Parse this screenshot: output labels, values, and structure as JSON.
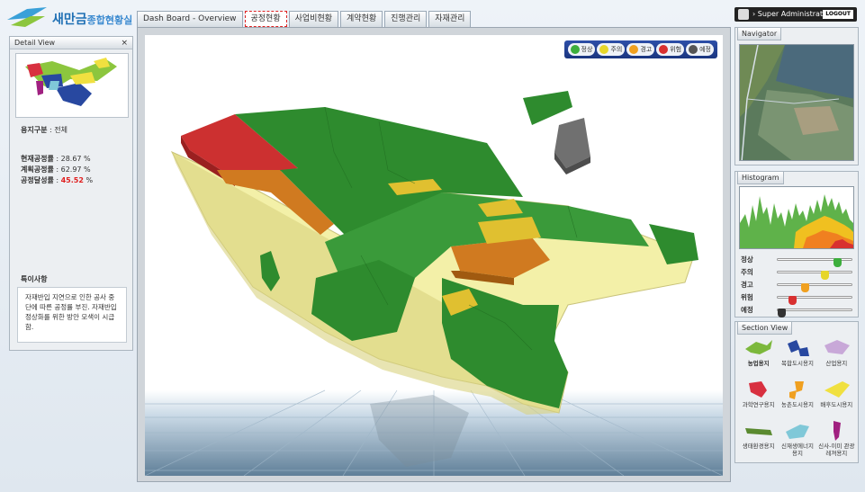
{
  "header": {
    "logo_main": "새만금",
    "logo_sub": "종합현황실",
    "tabs": [
      {
        "label": "Dash Board - Overview"
      },
      {
        "label": "공정현황"
      },
      {
        "label": "사업비현황"
      },
      {
        "label": "계약현황"
      },
      {
        "label": "진행관리"
      },
      {
        "label": "자재관리"
      }
    ],
    "active_tab": "공정현황",
    "user_label": "Super Administrator",
    "logout_label": "LOGOUT"
  },
  "detail_view": {
    "title": "Detail View",
    "close": "×",
    "zone_label": "용지구분",
    "zone_value": ": 전체",
    "stats": [
      {
        "label": "현재공정률",
        "value": ": 28.67 %"
      },
      {
        "label": "계획공정률",
        "value": ": 62.97 %"
      },
      {
        "label": "공정달성률",
        "value_prefix": ": ",
        "value": "45.52",
        "value_suffix": " %"
      }
    ],
    "notice_title": "특이사항",
    "notice_text": "자재반입 지연으로 인한 공사 중단에 따른 공정률 부진. 자재반입 정상화를 위한 방안 모색이 시급함."
  },
  "legend": {
    "items": [
      {
        "label": "정상",
        "color": "#3cae3c"
      },
      {
        "label": "주의",
        "color": "#e6d62a"
      },
      {
        "label": "경고",
        "color": "#f0a020"
      },
      {
        "label": "위험",
        "color": "#d83030"
      },
      {
        "label": "예정",
        "color": "#555555"
      }
    ]
  },
  "navigator": {
    "title": "Navigator"
  },
  "histogram": {
    "title": "Histogram",
    "sliders": [
      {
        "label": "정상",
        "level": 0.78,
        "color": "#3cae3c"
      },
      {
        "label": "주의",
        "level": 0.62,
        "color": "#e6d62a"
      },
      {
        "label": "경고",
        "level": 0.36,
        "color": "#f0a020"
      },
      {
        "label": "위험",
        "level": 0.2,
        "color": "#d83030"
      },
      {
        "label": "예정",
        "level": 0.04,
        "color": "#333333"
      }
    ]
  },
  "section_view": {
    "title": "Section View",
    "items": [
      {
        "label": "농업용지",
        "color": "#7cb83c",
        "active": true
      },
      {
        "label": "복합도시용지",
        "color": "#2848a0"
      },
      {
        "label": "산업용지",
        "color": "#c8a8d8"
      },
      {
        "label": "과학연구용지",
        "color": "#d83040"
      },
      {
        "label": "농촌도시용지",
        "color": "#f0a020"
      },
      {
        "label": "배후도시용지",
        "color": "#f0e040"
      },
      {
        "label": "생태환경용지",
        "color": "#5a8a30"
      },
      {
        "label": "신재생에너지 용지",
        "color": "#80c8d8"
      },
      {
        "label": "신사-이미 관광레져용지",
        "color": "#a02080"
      }
    ]
  }
}
